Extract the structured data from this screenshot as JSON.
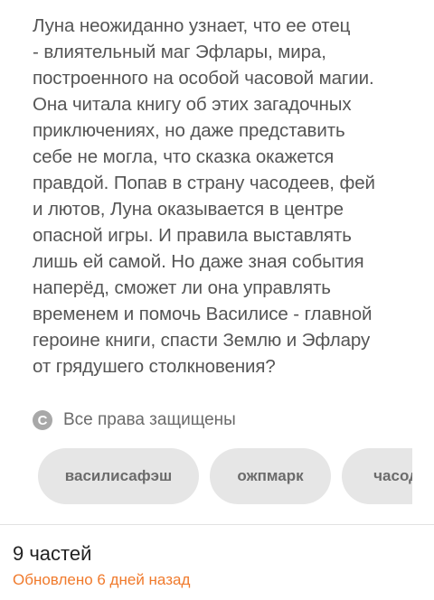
{
  "description": {
    "lines": [
      "Луна неожиданно узнает, что ее отец",
      "- влиятельный маг Эфлары, мира,",
      "построенного на особой часовой магии.",
      "Она читала книгу об этих загадочных",
      "приключениях, но даже представить",
      "себе не могла, что сказка окажется",
      "правдой. Попав в страну часодеев, фей",
      "и лютов, Луна оказывается в центре",
      "опасной игры. И правила выставлять",
      "лишь ей самой. Но даже зная события",
      "наперёд, сможет ли она управлять",
      "временем и помочь Василисе - главной",
      "героине книги, спасти Землю и Эфлару",
      "от грядушего столкновения?"
    ]
  },
  "copyright": {
    "icon_glyph": "C",
    "text": "Все права защищены"
  },
  "tags": [
    {
      "label": "василисафэш"
    },
    {
      "label": "ожпмарк"
    },
    {
      "label": "часодеи"
    }
  ],
  "story_info": {
    "parts": "9 частей",
    "updated": "Обновлено 6 дней назад",
    "updated_color": "#f07a2c"
  }
}
